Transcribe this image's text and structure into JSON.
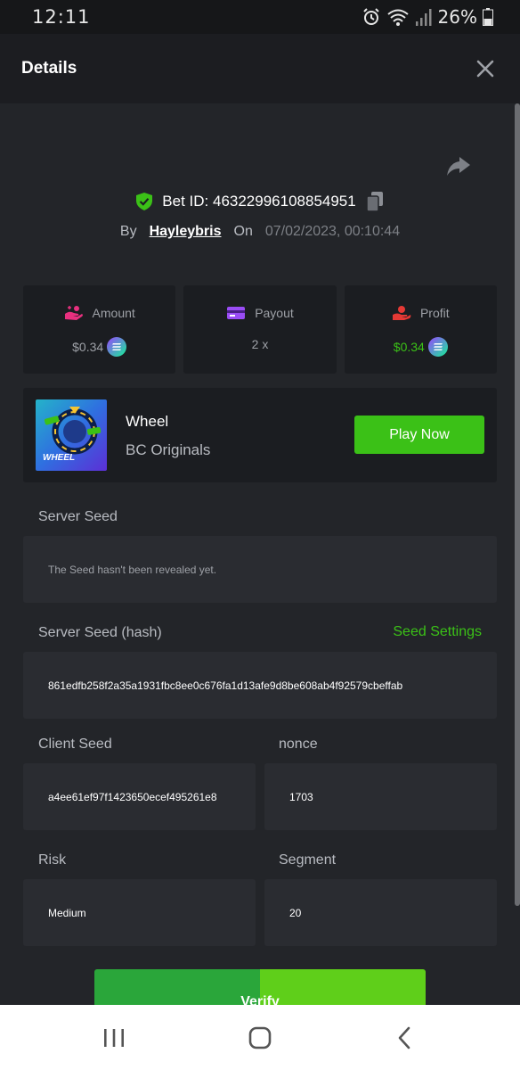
{
  "status_bar": {
    "time": "12:11",
    "battery_percent": "26%",
    "icons": [
      "alarm-icon",
      "wifi-icon",
      "signal-icon",
      "battery-icon"
    ]
  },
  "header": {
    "title": "Details",
    "close_icon": "close-icon"
  },
  "bet": {
    "label": "Bet ID:",
    "id": "46322996108854951",
    "by_label": "By",
    "username": "Hayleybris",
    "on_label": "On",
    "date": "07/02/2023, 00:10:44"
  },
  "stats": {
    "amount": {
      "label": "Amount",
      "value": "$0.34",
      "icon": "amount-icon"
    },
    "payout": {
      "label": "Payout",
      "value": "2 x",
      "icon": "card-icon"
    },
    "profit": {
      "label": "Profit",
      "value": "$0.34",
      "icon": "profit-icon"
    }
  },
  "game": {
    "thumb_text": "WHEEL",
    "name": "Wheel",
    "provider": "BC Originals",
    "play_label": "Play Now"
  },
  "fields": {
    "server_seed_label": "Server Seed",
    "server_seed_value": "The Seed hasn't been revealed yet.",
    "server_seed_hash_label": "Server Seed (hash)",
    "seed_settings_label": "Seed Settings",
    "server_seed_hash_value": "861edfb258f2a35a1931fbc8ee0c676fa1d13afe9d8be608ab4f92579cbeffab",
    "client_seed_label": "Client Seed",
    "client_seed_value": "a4ee61ef97f1423650ecef495261e8",
    "nonce_label": "nonce",
    "nonce_value": "1703",
    "risk_label": "Risk",
    "risk_value": "Medium",
    "segment_label": "Segment",
    "segment_value": "20"
  },
  "verify_label": "Verify",
  "colors": {
    "background": "#232529",
    "card": "#1b1d21",
    "field": "#2a2c31",
    "accent_green": "#3bc117",
    "muted_text": "#9ea1a7"
  }
}
